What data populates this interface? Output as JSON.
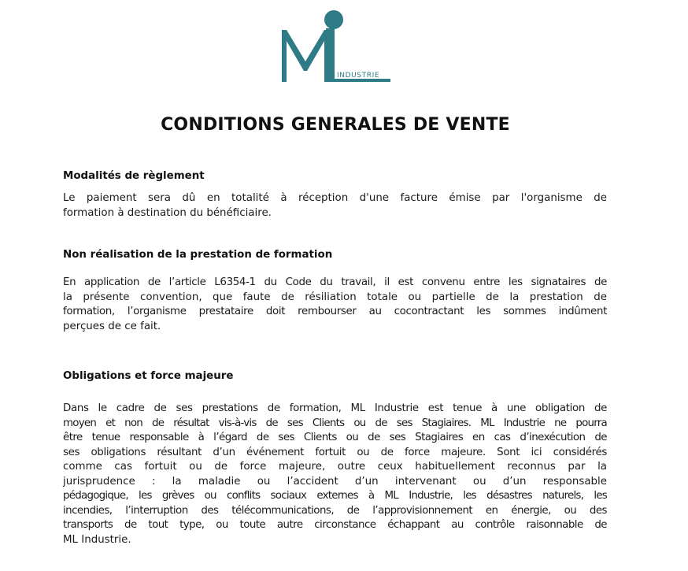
{
  "logo": {
    "letters": "ML",
    "subtitle": "INDUSTRIE",
    "color": "#2e7b85"
  },
  "document": {
    "title": "CONDITIONS GENERALES DE VENTE"
  },
  "sections": [
    {
      "heading": "Modalités de règlement",
      "lines": [
        "Le paiement sera dû en totalité à réception d'une facture émise par l'organisme de",
        "formation à destination du bénéficiaire."
      ]
    },
    {
      "heading": "Non réalisation de la prestation de formation",
      "lines": [
        "En application de l’article L6354-1 du Code du travail, il est convenu entre les signataires de",
        "la présente convention, que faute de résiliation totale ou partielle de la prestation de",
        "formation, l’organisme prestataire doit rembourser au cocontractant les sommes indûment",
        "perçues de ce fait."
      ]
    },
    {
      "heading": "Obligations et force majeure",
      "lines": [
        "Dans le cadre de ses prestations de formation, ML Industrie est tenue à une obligation de",
        "moyen et non de résultat vis-à-vis de ses Clients ou de ses Stagiaires. ML Industrie ne pourra",
        "être tenue responsable à l’égard de ses Clients ou de ses Stagiaires en cas d’inexécution de",
        "ses obligations résultant d’un événement fortuit ou de force majeure. Sont ici considérés",
        "comme cas fortuit ou de force majeure, outre ceux habituellement reconnus par la",
        "jurisprudence : la maladie ou l’accident d’un intervenant ou d’un responsable",
        "pédagogique, les grèves ou conflits sociaux externes à ML Industrie, les désastres naturels, les",
        "incendies, l’interruption des télécommunications, de l’approvisionnement en énergie, ou des",
        "transports de tout type, ou toute autre circonstance échappant au contrôle raisonnable de",
        "ML Industrie."
      ]
    }
  ]
}
